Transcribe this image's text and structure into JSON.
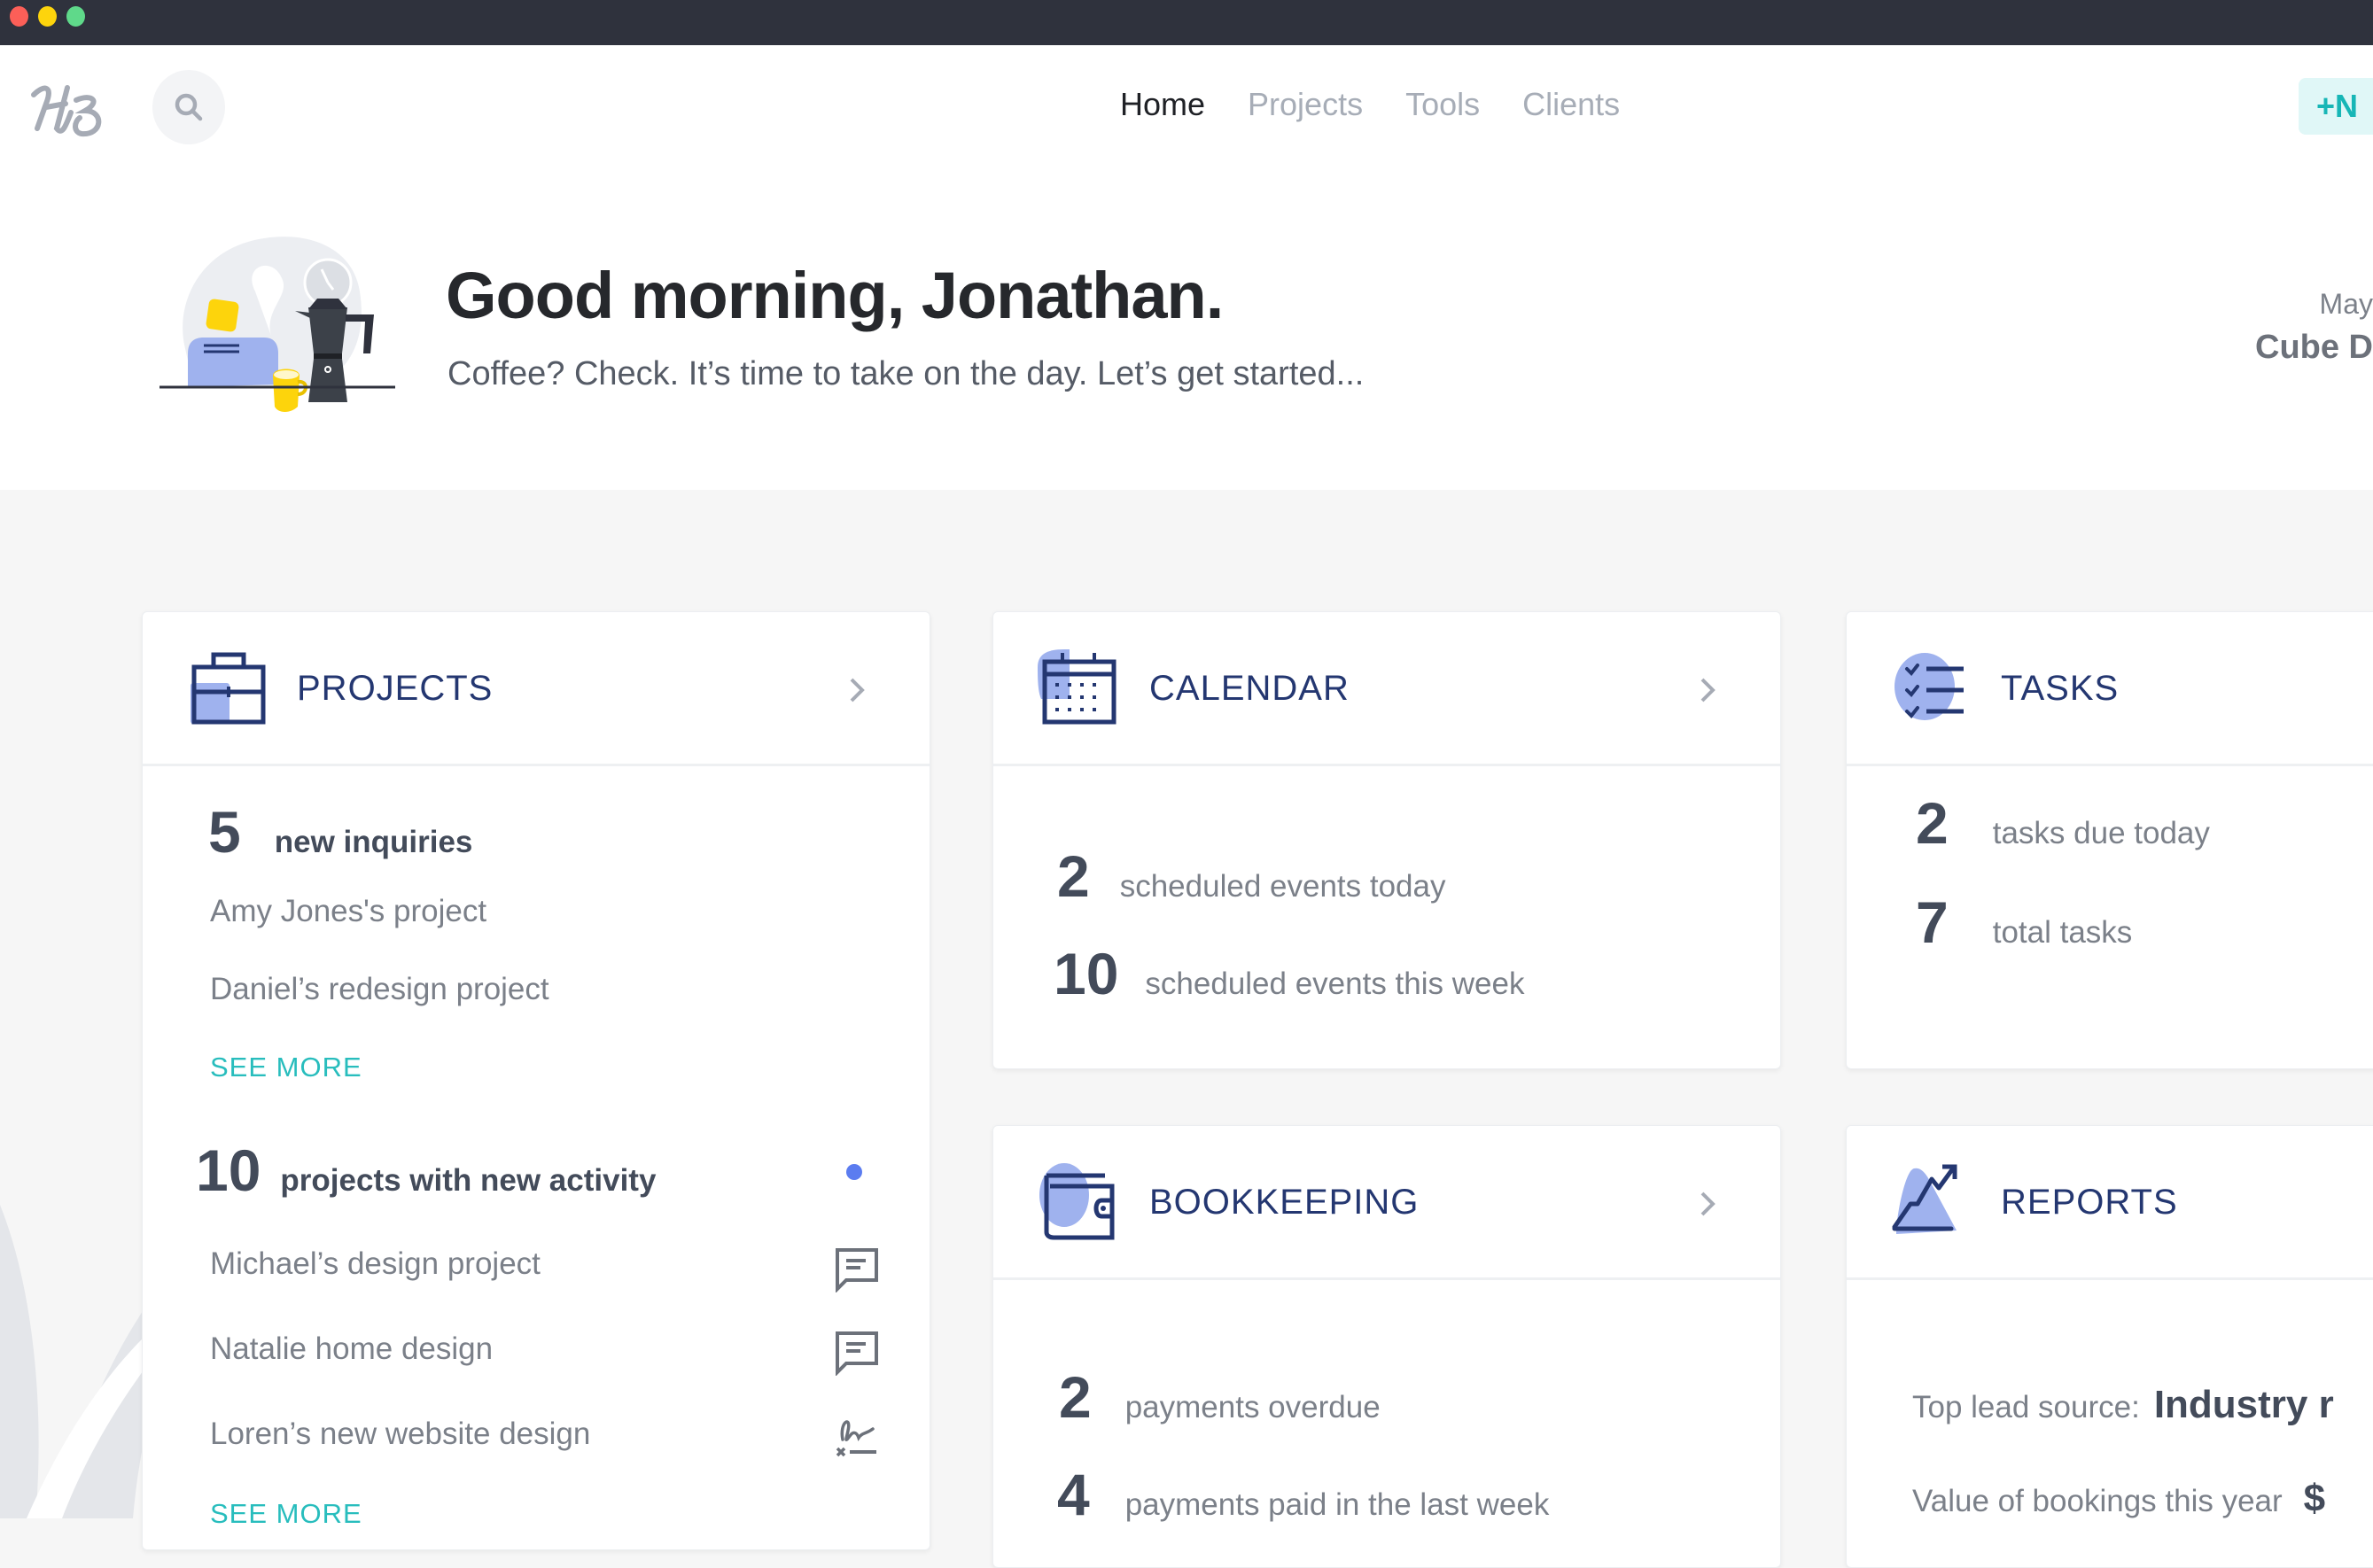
{
  "window": {
    "controls": [
      "close",
      "minimize",
      "maximize"
    ]
  },
  "nav": {
    "logo_text": "HB",
    "search_icon": "search-icon",
    "links": [
      {
        "label": "Home",
        "active": true
      },
      {
        "label": "Projects",
        "active": false
      },
      {
        "label": "Tools",
        "active": false
      },
      {
        "label": "Clients",
        "active": false
      }
    ],
    "new_button": {
      "icon": "+",
      "label": "N"
    }
  },
  "hero": {
    "title": "Good morning, Jonathan.",
    "subtitle": "Coffee? Check. It’s time to take on the day. Let’s get started...",
    "date": "May",
    "company": "Cube D"
  },
  "cards": {
    "projects": {
      "title": "PROJECTS",
      "inquiries": {
        "count": "5",
        "label": "new inquiries",
        "items": [
          "Amy Jones's project",
          "Daniel’s redesign project"
        ],
        "see_more": "SEE MORE"
      },
      "activity": {
        "count": "10",
        "label": "projects with new activity",
        "items": [
          {
            "label": "Michael’s design project",
            "icon": "message-icon"
          },
          {
            "label": "Natalie home design",
            "icon": "message-icon"
          },
          {
            "label": "Loren’s new website design",
            "icon": "signature-icon"
          }
        ],
        "see_more": "SEE MORE"
      }
    },
    "calendar": {
      "title": "CALENDAR",
      "stats": [
        {
          "count": "2",
          "label": "scheduled events today"
        },
        {
          "count": "10",
          "label": "scheduled events this week"
        }
      ]
    },
    "tasks": {
      "title": "TASKS",
      "stats": [
        {
          "count": "2",
          "label": "tasks due today"
        },
        {
          "count": "7",
          "label": "total tasks"
        }
      ]
    },
    "bookkeeping": {
      "title": "BOOKKEEPING",
      "stats": [
        {
          "count": "2",
          "label": "payments overdue"
        },
        {
          "count": "4",
          "label": "payments paid in the last week"
        }
      ]
    },
    "reports": {
      "title": "REPORTS",
      "rows": [
        {
          "label": "Top lead source:",
          "value": "Industry r"
        },
        {
          "label": "Value of bookings this year",
          "value": "$"
        }
      ]
    }
  },
  "colors": {
    "accent_teal": "#28bdbd",
    "icon_navy": "#243771",
    "icon_fill": "#9fb2ee",
    "unread_dot": "#5b7cf0"
  }
}
